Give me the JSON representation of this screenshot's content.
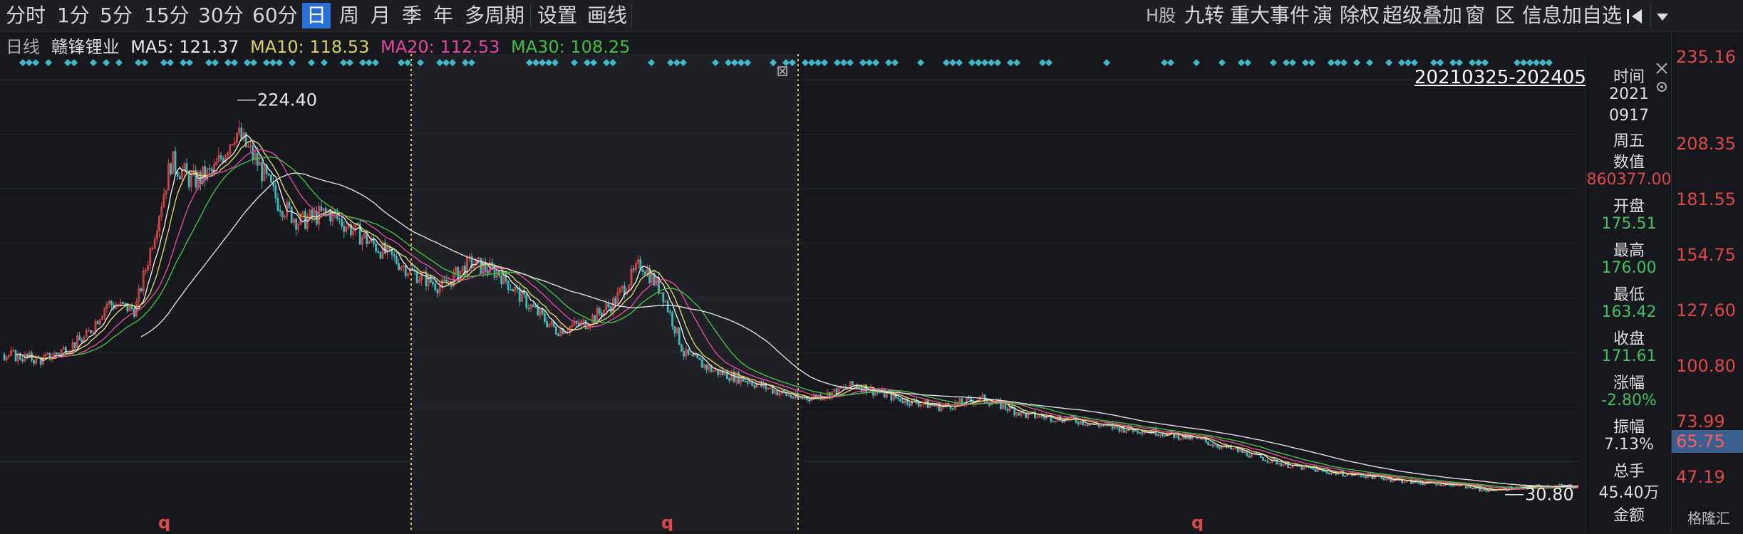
{
  "toolbar": {
    "periods": [
      "分时",
      "1分",
      "5分",
      "15分",
      "30分",
      "60分",
      "日",
      "周",
      "月",
      "季",
      "年",
      "多周期",
      "设置",
      "画线"
    ],
    "active_period": "日",
    "right_tools": [
      "H股",
      "九转",
      "重大事件",
      "演",
      "除权",
      "超级叠加",
      "窗",
      "区",
      "信息",
      "加自选"
    ]
  },
  "ma_row": {
    "label": "日线",
    "stock_name": "赣锋锂业",
    "ma5": "MA5: 121.37",
    "ma10": "MA10: 118.53",
    "ma20": "MA20: 112.53",
    "ma30": "MA30: 108.25"
  },
  "colors": {
    "up": "#e04848",
    "down": "#3fb8b8",
    "ma5": "#e8e8e8",
    "ma10": "#e0d060",
    "ma20": "#e048a0",
    "ma30": "#40c040",
    "ma_long": "#dddddd",
    "event_dot": "#3fb8c8",
    "marker": "#e04848"
  },
  "chart": {
    "date_range": "20210325-20240528",
    "high_label": "224.40",
    "low_label": "30.80",
    "event_marks": [
      "q",
      "q",
      "q"
    ]
  },
  "chart_data": {
    "type": "candlestick",
    "ylim": [
      20.0,
      240.0
    ],
    "price_ticks": [
      "235.16",
      "208.35",
      "181.55",
      "154.75",
      "127.60",
      "100.80",
      "73.99",
      "47.19"
    ],
    "current_price": "65.75",
    "high": 224.4,
    "low": 30.8
  },
  "info_panel": {
    "time_label": "时间",
    "date_year": "2021",
    "date_md": "0917",
    "weekday": "周五",
    "value_label": "数值",
    "value": "860377.00",
    "open_label": "开盘",
    "open": "175.51",
    "high_label": "最高",
    "high": "176.00",
    "low_label": "最低",
    "low": "163.42",
    "close_label": "收盘",
    "close": "171.61",
    "change_label": "涨幅",
    "change": "-2.80%",
    "amplitude_label": "振幅",
    "amplitude": "7.13%",
    "volume_label": "总手",
    "volume": "45.40万",
    "amount_label": "金额"
  },
  "logo": "格隆汇"
}
